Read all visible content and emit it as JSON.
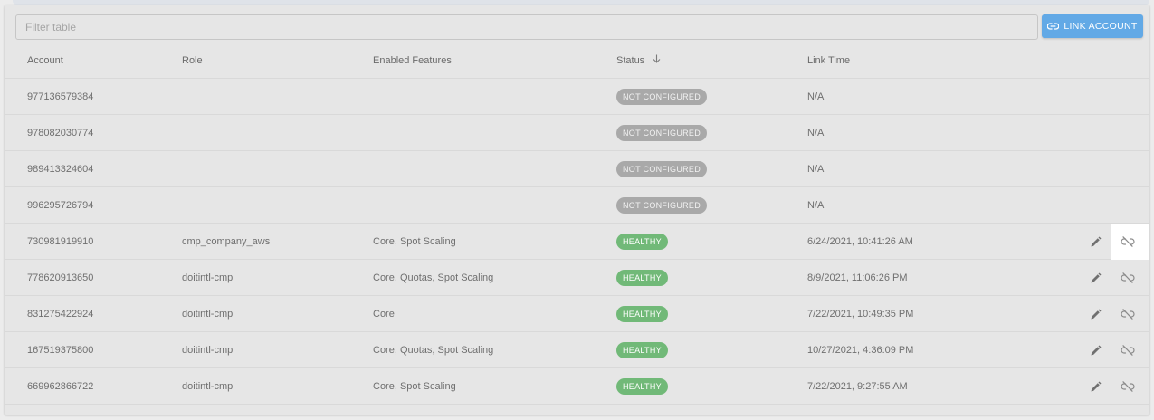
{
  "toolbar": {
    "filter_placeholder": "Filter table",
    "filter_value": "",
    "link_button_label": "LINK ACCOUNT",
    "link_button_icon": "link-icon",
    "accent_color": "#62a9e6"
  },
  "table": {
    "columns": [
      {
        "key": "account",
        "label": "Account"
      },
      {
        "key": "role",
        "label": "Role"
      },
      {
        "key": "features",
        "label": "Enabled Features"
      },
      {
        "key": "status",
        "label": "Status",
        "sort": "descending",
        "sort_icon": "arrow-down-icon"
      },
      {
        "key": "link_time",
        "label": "Link Time"
      }
    ],
    "status_colors": {
      "NOT CONFIGURED": "#a9a9a9",
      "HEALTHY": "#71b978"
    },
    "rows": [
      {
        "account": "977136579384",
        "role": "",
        "features": "",
        "status": "NOT CONFIGURED",
        "link_time": "N/A",
        "actions": false,
        "highlight_unlink": false
      },
      {
        "account": "978082030774",
        "role": "",
        "features": "",
        "status": "NOT CONFIGURED",
        "link_time": "N/A",
        "actions": false,
        "highlight_unlink": false
      },
      {
        "account": "989413324604",
        "role": "",
        "features": "",
        "status": "NOT CONFIGURED",
        "link_time": "N/A",
        "actions": false,
        "highlight_unlink": false
      },
      {
        "account": "996295726794",
        "role": "",
        "features": "",
        "status": "NOT CONFIGURED",
        "link_time": "N/A",
        "actions": false,
        "highlight_unlink": false
      },
      {
        "account": "730981919910",
        "role": "cmp_company_aws",
        "features": "Core, Spot Scaling",
        "status": "HEALTHY",
        "link_time": "6/24/2021, 10:41:26 AM",
        "actions": true,
        "highlight_unlink": true
      },
      {
        "account": "778620913650",
        "role": "doitintl-cmp",
        "features": "Core, Quotas, Spot Scaling",
        "status": "HEALTHY",
        "link_time": "8/9/2021, 11:06:26 PM",
        "actions": true,
        "highlight_unlink": false
      },
      {
        "account": "831275422924",
        "role": "doitintl-cmp",
        "features": "Core",
        "status": "HEALTHY",
        "link_time": "7/22/2021, 10:49:35 PM",
        "actions": true,
        "highlight_unlink": false
      },
      {
        "account": "167519375800",
        "role": "doitintl-cmp",
        "features": "Core, Quotas, Spot Scaling",
        "status": "HEALTHY",
        "link_time": "10/27/2021, 4:36:09 PM",
        "actions": true,
        "highlight_unlink": false
      },
      {
        "account": "669962866722",
        "role": "doitintl-cmp",
        "features": "Core, Spot Scaling",
        "status": "HEALTHY",
        "link_time": "7/22/2021, 9:27:55 AM",
        "actions": true,
        "highlight_unlink": false
      }
    ],
    "row_action_icons": [
      "pencil-edit-icon",
      "unlink-icon"
    ]
  }
}
